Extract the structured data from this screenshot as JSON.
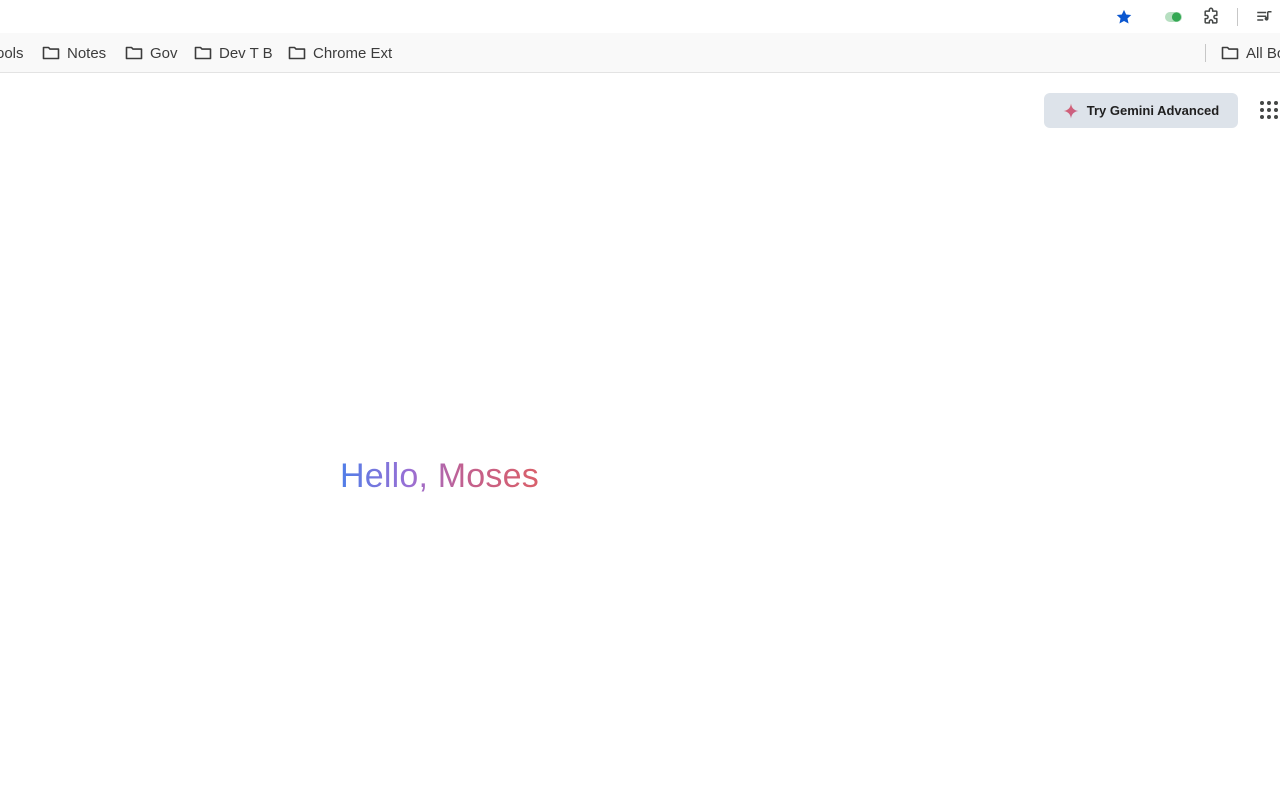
{
  "toolbar": {
    "bookmark_star_icon": "star-filled-icon",
    "extension_toggle_icon": "toggle-icon",
    "extensions_icon": "puzzle-icon",
    "media_icon": "media-queue-icon",
    "colors": {
      "star": "#0b57d0",
      "toggle": "#34a853"
    }
  },
  "bookmarks": {
    "items": [
      {
        "label": "ools",
        "icon": "folder-icon"
      },
      {
        "label": "Notes",
        "icon": "folder-icon"
      },
      {
        "label": "Gov",
        "icon": "folder-icon"
      },
      {
        "label": "Dev T B",
        "icon": "folder-icon"
      },
      {
        "label": "Chrome Ext",
        "icon": "folder-icon"
      }
    ],
    "all_bookmarks_label": "All Bo"
  },
  "header": {
    "gemini_button_label": "Try Gemini Advanced",
    "gemini_icon": "sparkle-icon",
    "apps_icon": "apps-grid-icon"
  },
  "main": {
    "greeting": "Hello, Moses"
  }
}
